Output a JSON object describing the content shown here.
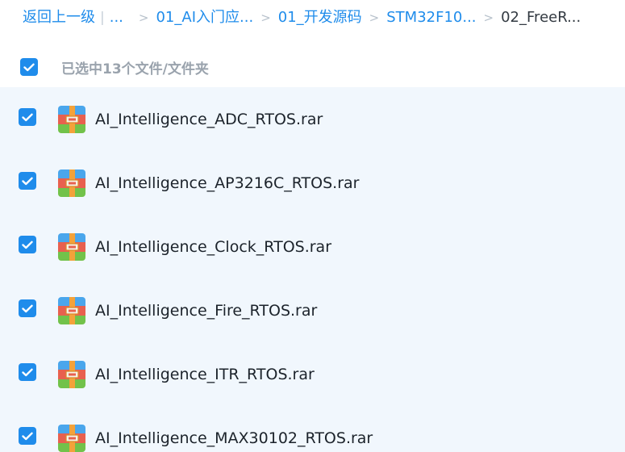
{
  "breadcrumb": {
    "back_label": "返回上一级",
    "pipe": "|",
    "ellipsis": "...",
    "separator": ">",
    "items": [
      {
        "label": "01_AI入门应..."
      },
      {
        "label": "01_开发源码"
      },
      {
        "label": "STM32F10..."
      }
    ],
    "current": "02_FreeR..."
  },
  "selection": {
    "all_checked": true,
    "label": "已选中13个文件/文件夹"
  },
  "files": [
    {
      "name": "AI_Intelligence_ADC_RTOS.rar",
      "checked": true,
      "icon": "rar-archive-icon"
    },
    {
      "name": "AI_Intelligence_AP3216C_RTOS.rar",
      "checked": true,
      "icon": "rar-archive-icon"
    },
    {
      "name": "AI_Intelligence_Clock_RTOS.rar",
      "checked": true,
      "icon": "rar-archive-icon"
    },
    {
      "name": "AI_Intelligence_Fire_RTOS.rar",
      "checked": true,
      "icon": "rar-archive-icon"
    },
    {
      "name": "AI_Intelligence_ITR_RTOS.rar",
      "checked": true,
      "icon": "rar-archive-icon"
    },
    {
      "name": "AI_Intelligence_MAX30102_RTOS.rar",
      "checked": true,
      "icon": "rar-archive-icon"
    }
  ],
  "colors": {
    "accent": "#1f8ceb",
    "list_background": "#f1f7fd",
    "muted_text": "#9aa3ad"
  }
}
